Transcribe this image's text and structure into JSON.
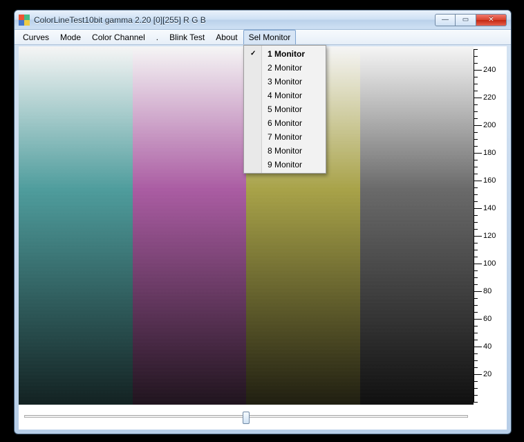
{
  "window": {
    "title": "ColorLineTest10bit gamma 2.20 [0][255]   R G B"
  },
  "menubar": {
    "items": [
      {
        "label": "Curves"
      },
      {
        "label": "Mode"
      },
      {
        "label": "Color Channel"
      },
      {
        "label": "."
      },
      {
        "label": "Blink Test"
      },
      {
        "label": "About"
      },
      {
        "label": "Sel Monitor",
        "open": true
      }
    ]
  },
  "dropdown": {
    "items": [
      {
        "label": "1 Monitor",
        "selected": true
      },
      {
        "label": "2 Monitor"
      },
      {
        "label": "3 Monitor"
      },
      {
        "label": "4 Monitor"
      },
      {
        "label": "5 Monitor"
      },
      {
        "label": "6 Monitor"
      },
      {
        "label": "7 Monitor"
      },
      {
        "label": "8 Monitor"
      },
      {
        "label": "9 Monitor"
      }
    ]
  },
  "ruler": {
    "max": 255,
    "majors": [
      240,
      220,
      200,
      180,
      160,
      140,
      120,
      100,
      80,
      60,
      40,
      20
    ]
  },
  "slider": {
    "value_pct": 50
  },
  "winbtns": {
    "min": "—",
    "max": "▭",
    "close": "✕"
  }
}
